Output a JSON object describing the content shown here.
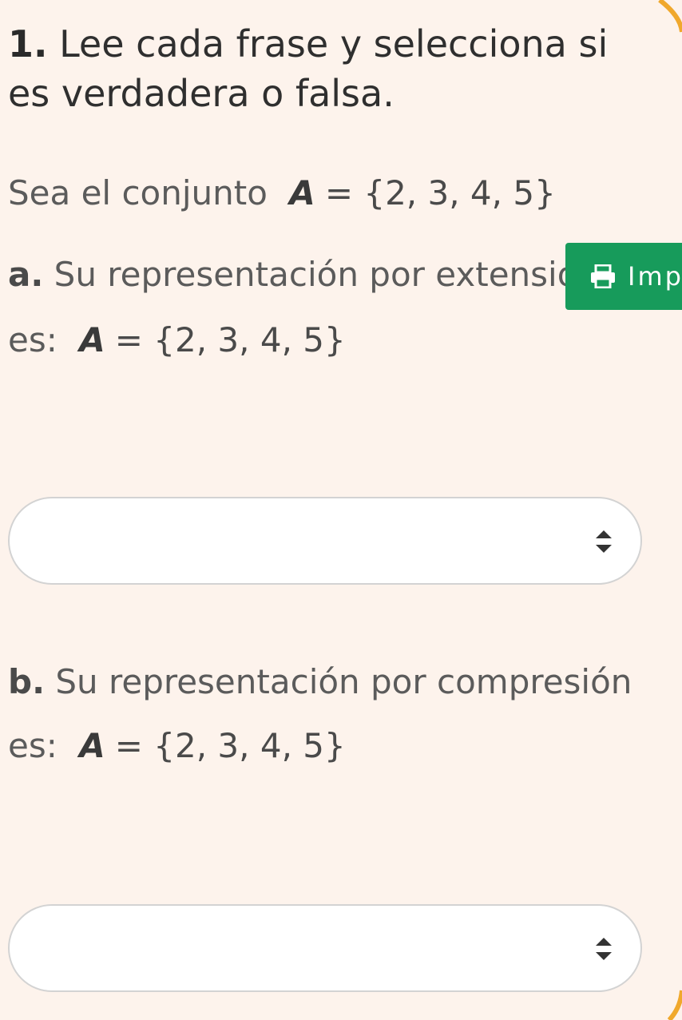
{
  "question": {
    "number": "1.",
    "text": "Lee cada frase y selecciona si es verdadera o falsa."
  },
  "set_intro": {
    "text": "Sea el conjunto",
    "math_var": "A",
    "math_expr": "= {2, 3, 4, 5}"
  },
  "item_a": {
    "letter": "a.",
    "text_line1": "Su representación por extensión",
    "text_line2": "es:",
    "math_var": "A",
    "math_expr": "= {2, 3, 4, 5}",
    "select_value": ""
  },
  "item_b": {
    "letter": "b.",
    "text_line1": "Su representación por compresión",
    "text_line2": "es:",
    "math_var": "A",
    "math_expr": "= {2, 3, 4, 5}",
    "select_value": ""
  },
  "print_button": {
    "label": "Imp",
    "icon": "printer-icon",
    "color": "#179b5b"
  },
  "colors": {
    "background": "#fdf3ec",
    "accent_border": "#f0a82c"
  }
}
